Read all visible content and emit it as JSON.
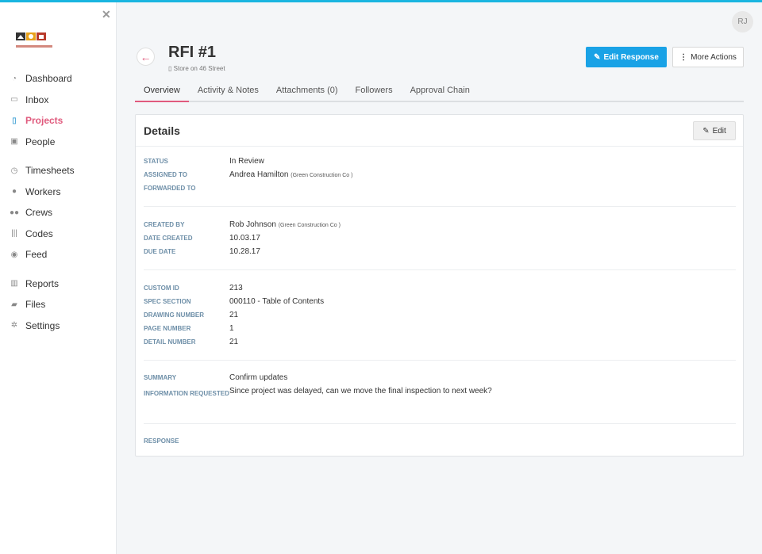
{
  "sidebar": {
    "items": [
      {
        "label": "Dashboard",
        "icon": "dashboard-icon"
      },
      {
        "label": "Inbox",
        "icon": "inbox-icon"
      },
      {
        "label": "Projects",
        "icon": "projects-icon",
        "active": true
      },
      {
        "label": "People",
        "icon": "people-icon"
      },
      {
        "label": "Timesheets",
        "icon": "clock-icon"
      },
      {
        "label": "Workers",
        "icon": "worker-icon"
      },
      {
        "label": "Crews",
        "icon": "crews-icon"
      },
      {
        "label": "Codes",
        "icon": "barcode-icon"
      },
      {
        "label": "Feed",
        "icon": "chat-icon"
      },
      {
        "label": "Reports",
        "icon": "chart-icon"
      },
      {
        "label": "Files",
        "icon": "folder-icon"
      },
      {
        "label": "Settings",
        "icon": "gear-icon"
      }
    ]
  },
  "header": {
    "avatar_initials": "RJ",
    "title": "RFI #1",
    "subtitle": "Store on 46 Street",
    "edit_response_label": "Edit Response",
    "more_actions_label": "More Actions"
  },
  "tabs": [
    "Overview",
    "Activity & Notes",
    "Attachments (0)",
    "Followers",
    "Approval Chain"
  ],
  "details": {
    "title": "Details",
    "edit_label": "Edit",
    "status_label": "STATUS",
    "status_value": "In Review",
    "assigned_label": "ASSIGNED TO",
    "assigned_value": "Andrea Hamilton",
    "assigned_company": "(Green Construction Co )",
    "forwarded_label": "FORWARDED TO",
    "created_by_label": "CREATED BY",
    "created_by_value": "Rob Johnson",
    "created_by_company": "(Green Construction Co )",
    "date_created_label": "DATE CREATED",
    "date_created_value": "10.03.17",
    "due_date_label": "DUE DATE",
    "due_date_value": "10.28.17",
    "custom_id_label": "CUSTOM ID",
    "custom_id_value": "213",
    "spec_section_label": "SPEC SECTION",
    "spec_section_value": "000110 - Table of Contents",
    "drawing_number_label": "DRAWING NUMBER",
    "drawing_number_value": "21",
    "page_number_label": "PAGE NUMBER",
    "page_number_value": "1",
    "detail_number_label": "DETAIL NUMBER",
    "detail_number_value": "21",
    "summary_label": "SUMMARY",
    "summary_value": "Confirm updates",
    "info_label": "INFORMATION REQUESTED",
    "info_value": "Since project was delayed, can we move the final inspection to next week?",
    "response_label": "RESPONSE"
  },
  "colors": {
    "accent": "#e05a7d",
    "primary": "#19a2e6",
    "label": "#6e8fa8"
  }
}
